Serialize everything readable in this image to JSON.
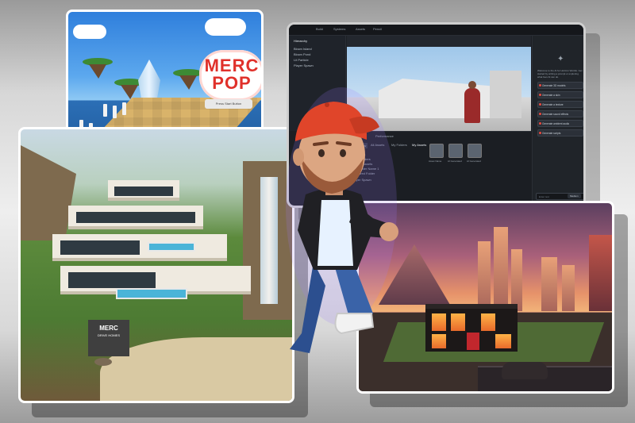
{
  "island_scene": {
    "logo_line1": "MERC",
    "logo_line2": "POP",
    "sign_text": "Press Start Button"
  },
  "mansion_scene": {
    "sign_title": "MERC",
    "sign_subtitle": "DRIVE HOMES"
  },
  "editor": {
    "top_tabs": [
      "Build",
      "Systems",
      "Assets",
      "Pencil"
    ],
    "hierarchy_title": "Hierarchy",
    "hierarchy_items": [
      "Blown Island",
      "Blown Pond",
      "Lit Particle",
      "Player Spawn"
    ],
    "bottom_tabs": [
      "Console",
      "Performance"
    ],
    "asset_filters": [
      "Add New",
      "All Assets",
      "My Folders",
      "My Assets"
    ],
    "folders": [
      "All Assets",
      "My Folders",
      "My Assets",
      "Folder Name 1",
      "Shared Folder"
    ],
    "assets": [
      "Asset Name",
      "AI Generated",
      "AI Generated"
    ],
    "side_welcome": "Welcome to the AI for Horizon Worlds. Get started by writing a prompt or exploring what Gen AI can do.",
    "side_buttons": [
      "Generate 3D models",
      "Generate a skin",
      "Generate a texture",
      "Generate sound effects",
      "Generate ambient audio",
      "Generate scripts"
    ],
    "chat_placeholder": "Enter text",
    "model_select": "Medium"
  },
  "colors": {
    "accent_red": "#e94a3f",
    "editor_bg": "#1c1f24",
    "avatar_cap": "#e0452a"
  }
}
